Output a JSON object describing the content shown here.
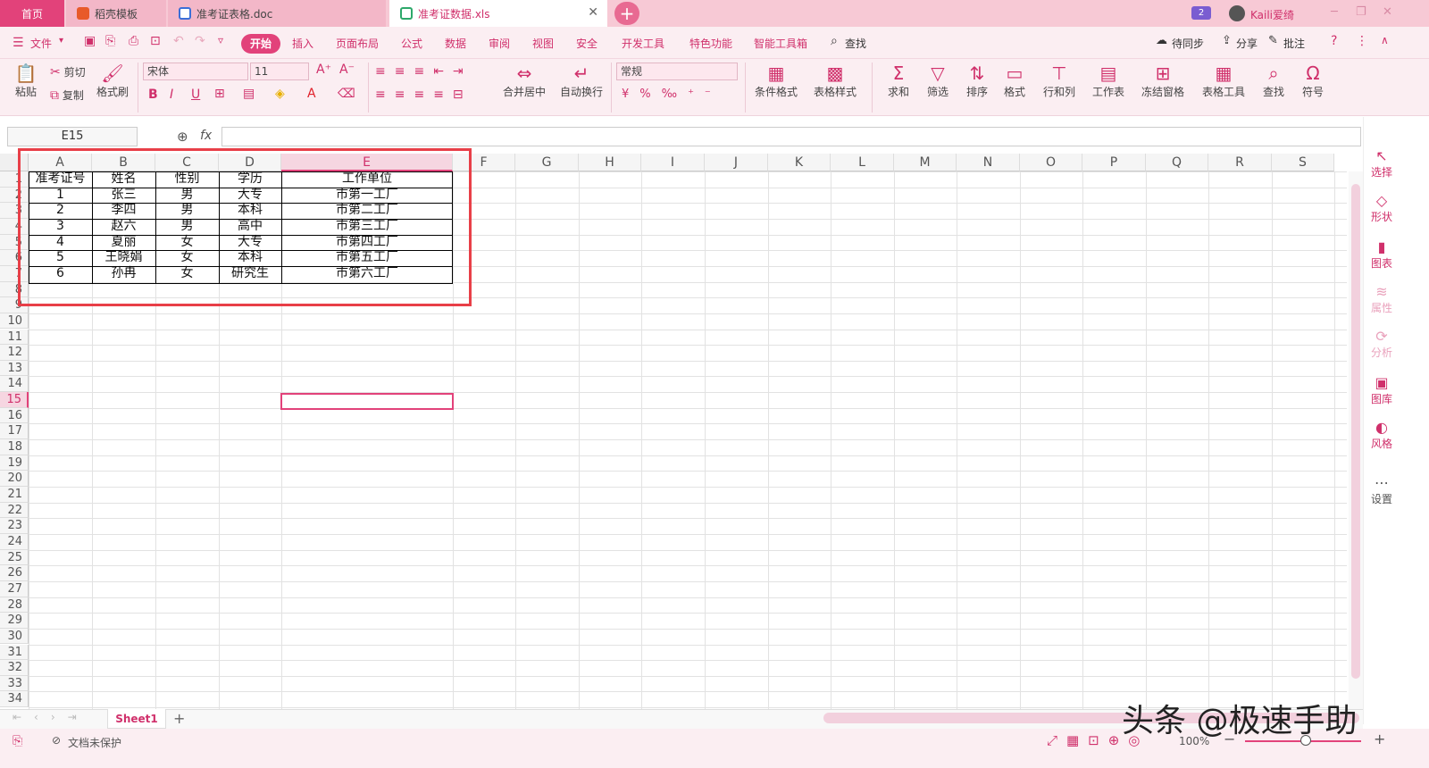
{
  "tabs": {
    "home": "首页",
    "daoke": "稻壳模板",
    "doc": "准考证表格.doc",
    "xls": "准考证数据.xls",
    "close": "✕",
    "add": "+"
  },
  "titlebar": {
    "badge": "2",
    "user": "Kaili爱绮"
  },
  "menu": {
    "file": "文件",
    "start": "开始",
    "insert": "插入",
    "layout": "页面布局",
    "formula": "公式",
    "data": "数据",
    "review": "审阅",
    "view": "视图",
    "security": "安全",
    "devtools": "开发工具",
    "special": "特色功能",
    "smart": "智能工具箱",
    "find": "查找",
    "sync": "待同步",
    "share": "分享",
    "comment": "批注"
  },
  "ribbon": {
    "paste": "粘贴",
    "cut": "剪切",
    "copy": "复制",
    "format_painter": "格式刷",
    "font": "宋体",
    "size": "11",
    "bold": "B",
    "italic": "I",
    "underline": "U",
    "number_format": "常规",
    "merge": "合并居中",
    "wrap": "自动换行",
    "cond_format": "条件格式",
    "table_style": "表格样式",
    "sum": "求和",
    "filter": "筛选",
    "sort": "排序",
    "format": "格式",
    "rowcol": "行和列",
    "sheet": "工作表",
    "freeze": "冻结窗格",
    "table_tools": "表格工具",
    "lookup": "查找",
    "symbol": "符号"
  },
  "formula_bar": {
    "cell_ref": "E15",
    "fx": "fx",
    "value": ""
  },
  "columns": [
    "A",
    "B",
    "C",
    "D",
    "E",
    "F",
    "G",
    "H",
    "I",
    "J",
    "K",
    "L",
    "M",
    "N",
    "O",
    "P",
    "Q",
    "R",
    "S"
  ],
  "rows": [
    "1",
    "2",
    "3",
    "4",
    "5",
    "6",
    "7",
    "8",
    "9",
    "10",
    "11",
    "12",
    "13",
    "14",
    "15",
    "16",
    "17",
    "18",
    "19",
    "20",
    "21",
    "22",
    "23",
    "24",
    "25",
    "26",
    "27",
    "28",
    "29",
    "30",
    "31",
    "32",
    "33",
    "34"
  ],
  "table": {
    "headers": [
      "准考证号",
      "姓名",
      "性别",
      "学历",
      "工作单位"
    ],
    "rows": [
      [
        "1",
        "张三",
        "男",
        "大专",
        "市第一工厂"
      ],
      [
        "2",
        "李四",
        "男",
        "本科",
        "市第二工厂"
      ],
      [
        "3",
        "赵六",
        "男",
        "高中",
        "市第三工厂"
      ],
      [
        "4",
        "夏丽",
        "女",
        "大专",
        "市第四工厂"
      ],
      [
        "5",
        "王晓娟",
        "女",
        "本科",
        "市第五工厂"
      ],
      [
        "6",
        "孙冉",
        "女",
        "研究生",
        "市第六工厂"
      ]
    ]
  },
  "right_panel": [
    "选择",
    "形状",
    "图表",
    "属性",
    "分析",
    "图库",
    "风格",
    "设置"
  ],
  "sheet_tab": "Sheet1",
  "status": {
    "protect": "文档未保护",
    "zoom": "100%"
  },
  "watermark": "头条 @极速手助",
  "colors": {
    "accent": "#e2427a",
    "highlight_box": "#e83f48"
  }
}
